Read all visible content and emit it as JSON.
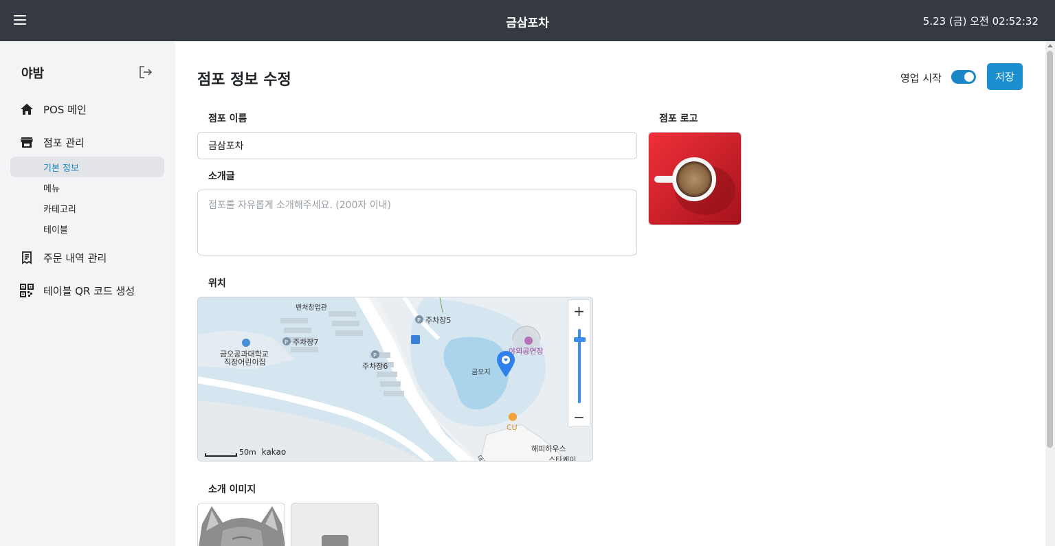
{
  "header": {
    "menu_icon": "hamburger-icon",
    "title": "금삼포차",
    "datetime": "5.23 (금) 오전 02:52:32"
  },
  "sidebar": {
    "user_name": "야밤",
    "logout_icon": "logout-icon",
    "items": [
      {
        "label": "POS 메인",
        "icon": "home-icon"
      },
      {
        "label": "점포 관리",
        "icon": "store-icon"
      },
      {
        "label": "주문 내역 관리",
        "icon": "receipt-icon"
      },
      {
        "label": "테이블 QR 코드 생성",
        "icon": "qr-code-icon"
      }
    ],
    "subitems": [
      {
        "label": "기본 정보",
        "active": true
      },
      {
        "label": "메뉴",
        "active": false
      },
      {
        "label": "카테고리",
        "active": false
      },
      {
        "label": "테이블",
        "active": false
      }
    ]
  },
  "page": {
    "title": "점포 정보 수정",
    "status_label": "영업 시작",
    "status_on": true,
    "save_label": "저장"
  },
  "form": {
    "name_label": "점포 이름",
    "name_value": "금삼포차",
    "intro_label": "소개글",
    "intro_placeholder": "점포를 자유롭게 소개해주세요. (200자 이내)",
    "logo_label": "점포 로고",
    "location_label": "위치",
    "images_label": "소개 이미지"
  },
  "map": {
    "labels": {
      "venture": "벤처창업관",
      "parking5": "주차장5",
      "parking7": "주차장7",
      "parking6": "주차장6",
      "daycare1": "금오공과대학교",
      "daycare2": "직장어린이집",
      "lake": "금오지",
      "stage": "야외공연장",
      "cu": "CU",
      "happy1": "해피하우스",
      "happy2": "스타케이",
      "road": "대학"
    },
    "scale": "50m",
    "brand": "kakao",
    "zoom_in": "+",
    "zoom_out": "−",
    "colors": {
      "water": "#a9d4ec",
      "campus": "#d6e6f1",
      "pin": "#2f80ed"
    }
  },
  "colors": {
    "accent": "#1b8fd0",
    "header_bg": "#353a42",
    "sidebar_bg": "#f3f4f5"
  }
}
